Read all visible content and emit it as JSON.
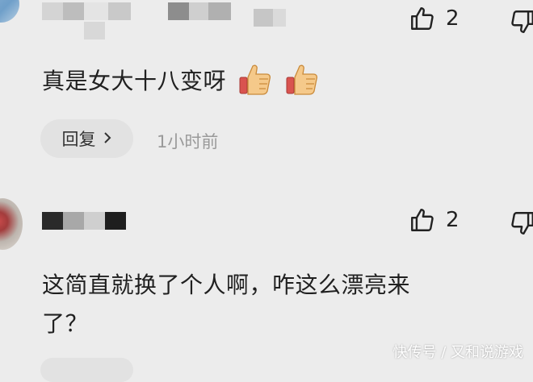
{
  "comments": [
    {
      "text": "真是女大十八变呀",
      "likes": "2",
      "reply_label": "回复",
      "time": "1小时前",
      "emoji": [
        "thumbs-up-emoji",
        "thumbs-up-emoji"
      ]
    },
    {
      "text_line1": "这简直就换了个人啊，咋这么漂亮来",
      "text_line2": "了？",
      "likes": "2"
    }
  ],
  "watermark": "快传号 / 又和说游戏",
  "colors": {
    "background": "#ececec",
    "reply_pill": "#e2e2e2",
    "timestamp": "#9a9a9a"
  }
}
